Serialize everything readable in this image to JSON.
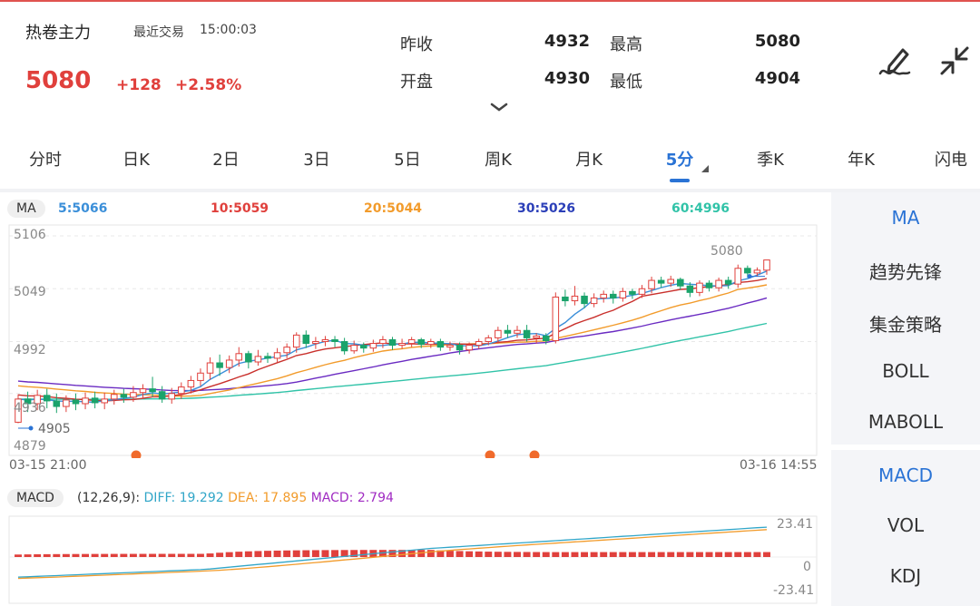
{
  "header": {
    "name": "热卷主力",
    "trade_label": "最近交易",
    "trade_time": "15:00:03",
    "price": "5080",
    "change": "+128",
    "change_pct": "+2.58%",
    "quotes": [
      {
        "label": "昨收",
        "value": "4932"
      },
      {
        "label": "最高",
        "value": "5080"
      },
      {
        "label": "开盘",
        "value": "4930"
      },
      {
        "label": "最低",
        "value": "4904"
      }
    ],
    "icons": [
      "signature-pen-icon",
      "collapse-arrows-icon",
      "chevron-down-icon"
    ]
  },
  "tabs": [
    {
      "label": "分时"
    },
    {
      "label": "日K"
    },
    {
      "label": "2日"
    },
    {
      "label": "3日"
    },
    {
      "label": "5日"
    },
    {
      "label": "周K"
    },
    {
      "label": "月K"
    },
    {
      "label": "5分",
      "active": true
    },
    {
      "label": "季K"
    },
    {
      "label": "年K"
    },
    {
      "label": "闪电"
    }
  ],
  "ma_bar": {
    "label": "MA",
    "values": [
      {
        "text": "5:5066",
        "color": "#3b8fd9"
      },
      {
        "text": "10:5059",
        "color": "#e0403c"
      },
      {
        "text": "20:5044",
        "color": "#f29b2b"
      },
      {
        "text": "30:5026",
        "color": "#2b3fb8"
      },
      {
        "text": "60:4996",
        "color": "#31c3a8"
      }
    ]
  },
  "colors": {
    "up": "#e0403c",
    "down": "#1aa36b",
    "accent": "#2a73d5",
    "ma5": "#3b8fd9",
    "ma10": "#c9302c",
    "ma20": "#f29b2b",
    "ma30": "#6a2bc2",
    "ma60": "#31c3a8",
    "marker": "#f06a2b"
  },
  "chart_data": [
    {
      "type": "candlestick",
      "y_ticks": [
        "5106",
        "5049",
        "4992",
        "4936",
        "4879"
      ],
      "ylim": [
        4879,
        5106
      ],
      "x_labels": [
        "03-15 21:00",
        "03-16 14:55"
      ],
      "annotations": {
        "high": "5080",
        "low": "4905"
      },
      "grid": true,
      "candles": [
        [
          4905,
          4930,
          4935,
          4904
        ],
        [
          4930,
          4925,
          4938,
          4916
        ],
        [
          4925,
          4934,
          4940,
          4918
        ],
        [
          4934,
          4928,
          4941,
          4920
        ],
        [
          4928,
          4922,
          4936,
          4915
        ],
        [
          4922,
          4929,
          4934,
          4916
        ],
        [
          4929,
          4925,
          4936,
          4918
        ],
        [
          4925,
          4931,
          4937,
          4919
        ],
        [
          4931,
          4926,
          4938,
          4920
        ],
        [
          4926,
          4930,
          4937,
          4919
        ],
        [
          4930,
          4935,
          4940,
          4924
        ],
        [
          4935,
          4932,
          4941,
          4926
        ],
        [
          4932,
          4937,
          4944,
          4927
        ],
        [
          4937,
          4941,
          4946,
          4930
        ],
        [
          4941,
          4938,
          4954,
          4932
        ],
        [
          4938,
          4930,
          4944,
          4926
        ],
        [
          4930,
          4936,
          4942,
          4925
        ],
        [
          4936,
          4943,
          4948,
          4930
        ],
        [
          4943,
          4950,
          4955,
          4936
        ],
        [
          4950,
          4958,
          4963,
          4944
        ],
        [
          4958,
          4969,
          4975,
          4951
        ],
        [
          4969,
          4964,
          4978,
          4955
        ],
        [
          4964,
          4972,
          4977,
          4958
        ],
        [
          4972,
          4979,
          4986,
          4965
        ],
        [
          4979,
          4970,
          4982,
          4963
        ],
        [
          4970,
          4976,
          4983,
          4966
        ],
        [
          4976,
          4974,
          4980,
          4969
        ],
        [
          4974,
          4980,
          4985,
          4970
        ],
        [
          4980,
          4986,
          4990,
          4974
        ],
        [
          4986,
          4999,
          5002,
          4980
        ],
        [
          4999,
          4990,
          5004,
          4985
        ],
        [
          4990,
          4992,
          4997,
          4984
        ],
        [
          4992,
          4994,
          4998,
          4987
        ],
        [
          4994,
          4992,
          4998,
          4986
        ],
        [
          4992,
          4982,
          4996,
          4978
        ],
        [
          4982,
          4988,
          4993,
          4979
        ],
        [
          4988,
          4985,
          4991,
          4980
        ],
        [
          4985,
          4990,
          4994,
          4981
        ],
        [
          4990,
          4994,
          4998,
          4985
        ],
        [
          4994,
          4988,
          4997,
          4983
        ],
        [
          4988,
          4990,
          4995,
          4984
        ],
        [
          4990,
          4994,
          4997,
          4986
        ],
        [
          4994,
          4989,
          4996,
          4985
        ],
        [
          4989,
          4992,
          4995,
          4985
        ],
        [
          4992,
          4986,
          4995,
          4982
        ],
        [
          4986,
          4988,
          4992,
          4982
        ],
        [
          4988,
          4983,
          4991,
          4978
        ],
        [
          4983,
          4988,
          4991,
          4979
        ],
        [
          4988,
          4992,
          4995,
          4984
        ],
        [
          4992,
          4996,
          4999,
          4988
        ],
        [
          4996,
          5004,
          5008,
          4990
        ],
        [
          5004,
          5001,
          5010,
          4996
        ],
        [
          5001,
          5004,
          5009,
          4996
        ],
        [
          5004,
          4996,
          5010,
          4992
        ],
        [
          4996,
          4998,
          5001,
          4990
        ],
        [
          4998,
          4993,
          5001,
          4989
        ],
        [
          4993,
          5040,
          5045,
          4990
        ],
        [
          5040,
          5036,
          5048,
          5030
        ],
        [
          5036,
          5041,
          5052,
          5031
        ],
        [
          5041,
          5033,
          5045,
          5028
        ],
        [
          5033,
          5039,
          5044,
          5029
        ],
        [
          5039,
          5043,
          5047,
          5034
        ],
        [
          5043,
          5039,
          5047,
          5033
        ],
        [
          5039,
          5046,
          5050,
          5035
        ],
        [
          5046,
          5043,
          5049,
          5038
        ],
        [
          5043,
          5049,
          5053,
          5039
        ],
        [
          5049,
          5058,
          5062,
          5044
        ],
        [
          5058,
          5055,
          5062,
          5050
        ],
        [
          5055,
          5059,
          5063,
          5051
        ],
        [
          5059,
          5052,
          5061,
          5048
        ],
        [
          5052,
          5045,
          5056,
          5040
        ],
        [
          5045,
          5055,
          5058,
          5041
        ],
        [
          5055,
          5050,
          5058,
          5046
        ],
        [
          5050,
          5058,
          5061,
          5046
        ],
        [
          5058,
          5054,
          5062,
          5049
        ],
        [
          5054,
          5071,
          5075,
          5050
        ],
        [
          5071,
          5066,
          5074,
          5061
        ],
        [
          5066,
          5069,
          5072,
          5062
        ],
        [
          5069,
          5080,
          5080,
          5064
        ]
      ]
    },
    {
      "type": "macd",
      "params": "(12,26,9):",
      "diff_label": "DIFF:",
      "diff": "19.292",
      "dea_label": "DEA:",
      "dea": "17.895",
      "macd_label": "MACD:",
      "macd": "2.794",
      "y_ticks": [
        "23.41",
        "0",
        "-23.41"
      ],
      "ylim": [
        -23.41,
        23.41
      ]
    }
  ],
  "side_panel": {
    "main_indicators": [
      "MA",
      "趋势先锋",
      "集金策略",
      "BOLL",
      "MABOLL"
    ],
    "sub_indicators": [
      "MACD",
      "VOL",
      "KDJ"
    ],
    "main_active": "MA",
    "sub_active": "MACD"
  }
}
